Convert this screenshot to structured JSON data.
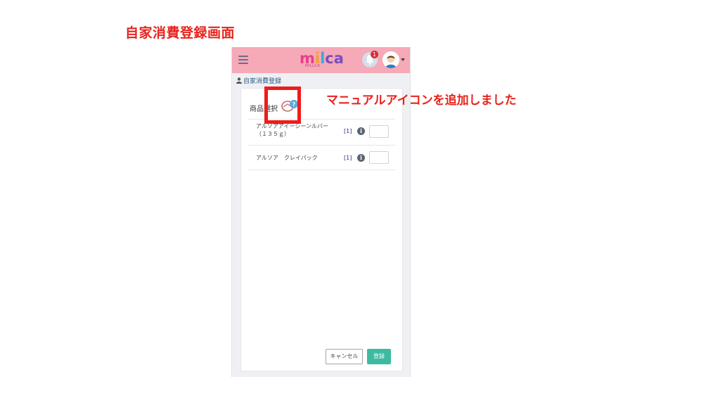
{
  "page_heading": "自家消費登録画面",
  "annotation": "マニュアルアイコンを追加しました",
  "header": {
    "logo_parts": [
      "m",
      "i",
      "l",
      "ca"
    ],
    "logo_tagline": "MILLCA",
    "notification_count": "1"
  },
  "breadcrumb": {
    "label": "自家消費登録"
  },
  "form": {
    "section_label": "商品選択",
    "items": [
      {
        "name": "アルソアアイーシーンルバー（１３５ｇ）",
        "count": "[1]",
        "info": "i",
        "quantity": ""
      },
      {
        "name": "アルソア　クレイパック",
        "count": "[1]",
        "info": "i",
        "quantity": ""
      }
    ],
    "cancel_label": "キャンセル",
    "submit_label": "登録"
  },
  "colors": {
    "header_bg": "#f6a9b6",
    "accent_red": "#e8231c",
    "submit_bg": "#3dbba0",
    "badge_bg": "#d42e3c"
  },
  "icons": {
    "menu": "hamburger-menu-icon",
    "bell": "bell-icon",
    "avatar": "user-avatar",
    "user": "user-icon",
    "manual": "manual-help-icon",
    "info": "info-icon"
  }
}
